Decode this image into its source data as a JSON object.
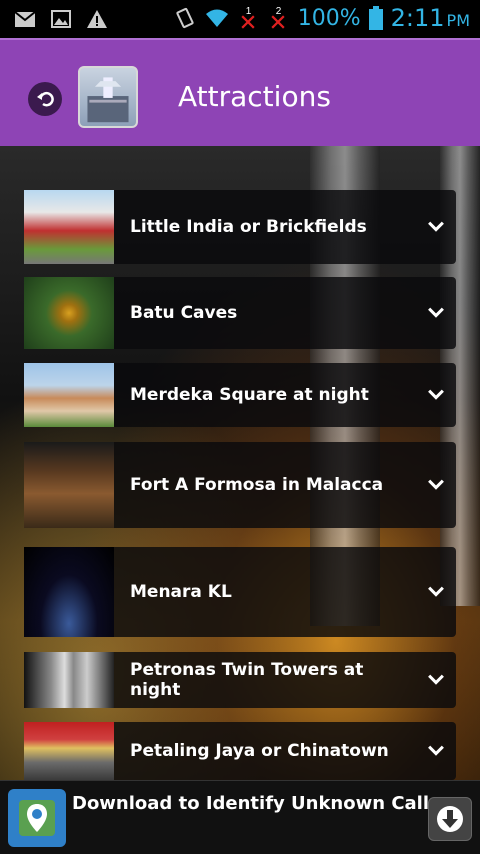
{
  "status_bar": {
    "battery_text": "100%",
    "time": "2:11",
    "ampm": "PM",
    "sim1": "1",
    "sim2": "2",
    "icons": [
      "gmail-icon",
      "image-icon",
      "warning-icon",
      "vibrate-icon",
      "wifi-icon",
      "signal-off-icon",
      "signal-off-icon",
      "battery-icon"
    ],
    "accent_color": "#33b5e5"
  },
  "header": {
    "title": "Attractions",
    "bg_color": "#8e44b5",
    "back_icon": "back-arrow-icon"
  },
  "attractions": [
    {
      "label": "Little India or Brickfields",
      "thumb": "little-india-photo"
    },
    {
      "label": "Batu Caves",
      "thumb": "batu-caves-photo"
    },
    {
      "label": "Merdeka Square at night",
      "thumb": "merdeka-square-photo"
    },
    {
      "label": "Fort A Formosa in Malacca",
      "thumb": "fort-formosa-photo"
    },
    {
      "label": "Menara KL",
      "thumb": "menara-kl-photo"
    },
    {
      "label": "Petronas Twin Towers at night",
      "thumb": "petronas-towers-photo"
    },
    {
      "label": "Petaling Jaya or Chinatown",
      "thumb": "chinatown-photo"
    }
  ],
  "ad": {
    "text": "Download to Identify Unknown Caller",
    "icon": "map-pin-icon",
    "button_icon": "download-icon"
  }
}
